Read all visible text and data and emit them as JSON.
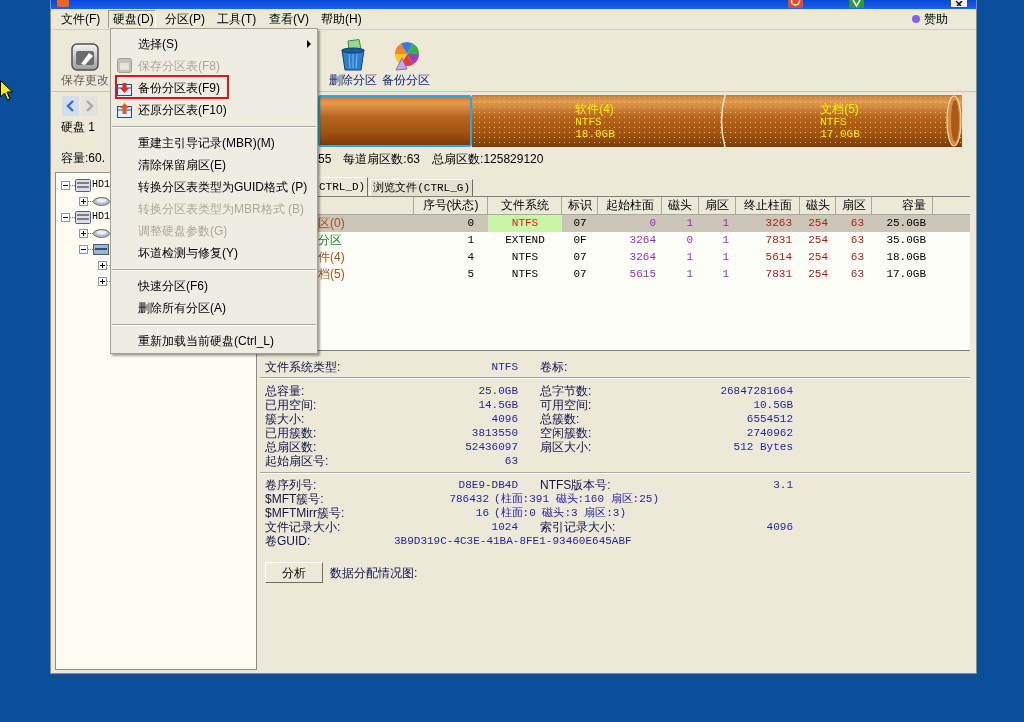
{
  "menu_bar": {
    "items": [
      {
        "label": "文件(F)",
        "selected": false
      },
      {
        "label": "硬盘(D)",
        "selected": true
      },
      {
        "label": "分区(P)",
        "selected": false
      },
      {
        "label": "工具(T)",
        "selected": false
      },
      {
        "label": "查看(V)",
        "selected": false
      },
      {
        "label": "帮助(H)",
        "selected": false
      }
    ],
    "sponsor": "赞助"
  },
  "toolbar": {
    "buttons": [
      {
        "kind": "save",
        "label": "保存更改",
        "disabled": true
      },
      {
        "kind": "delete",
        "label": "删除分区",
        "disabled": false
      },
      {
        "kind": "backup",
        "label": "备份分区",
        "disabled": false
      }
    ]
  },
  "disk_panel": {
    "nav_buttons": [
      {
        "kind": "prev",
        "disabled": false
      },
      {
        "kind": "next",
        "disabled": true
      }
    ],
    "disk_label": "硬盘 1",
    "capacity": "容量:60."
  },
  "disk_map": {
    "segments": [
      {
        "kind": "primary",
        "selected": true
      },
      {
        "kind": "logical",
        "selected": false,
        "name": "软件(4)",
        "filesystem": "NTFS",
        "size": "18.0GB"
      },
      {
        "kind": "logical",
        "selected": false,
        "name": "文档(5)",
        "filesystem": "NTFS",
        "size": "17.0GB"
      }
    ],
    "info": [
      "55",
      "每道扇区数:63",
      "总扇区数:125829120"
    ]
  },
  "tree": [
    {
      "kind": "disk",
      "label": "HD1",
      "expanded": true,
      "children": [
        {
          "kind": "partition",
          "expanded": false
        }
      ]
    },
    {
      "kind": "disk",
      "label": "HD1",
      "expanded": true,
      "children": [
        {
          "kind": "partition",
          "expanded": false
        },
        {
          "kind": "extended",
          "expanded": true,
          "children": [
            {
              "expanded": false
            },
            {
              "expanded": false
            }
          ]
        }
      ]
    }
  ],
  "tabs": [
    {
      "label": "CTRL_D)",
      "selected": true
    },
    {
      "label": "浏览文件(CTRL_G)",
      "selected": false
    }
  ],
  "table": {
    "columns": [
      "序号(状态)",
      "文件系统",
      "标识",
      "起始柱面",
      "磁头",
      "扇区",
      "终止柱面",
      "磁头",
      "扇区",
      "容量"
    ],
    "rows": [
      {
        "kind": "primary",
        "selected": true,
        "name": "区(0)",
        "cells": [
          "0",
          "NTFS",
          "07",
          "0",
          "1",
          "1",
          "3263",
          "254",
          "63",
          "25.0GB"
        ]
      },
      {
        "kind": "extended",
        "selected": false,
        "name": "分区",
        "cells": [
          "1",
          "EXTEND",
          "0F",
          "3264",
          "0",
          "1",
          "7831",
          "254",
          "63",
          "35.0GB"
        ]
      },
      {
        "kind": "logical",
        "selected": false,
        "name": "件(4)",
        "cells": [
          "4",
          "NTFS",
          "07",
          "3264",
          "1",
          "1",
          "5614",
          "254",
          "63",
          "18.0GB"
        ]
      },
      {
        "kind": "logical",
        "selected": false,
        "name": "档(5)",
        "cells": [
          "5",
          "NTFS",
          "07",
          "5615",
          "1",
          "1",
          "7831",
          "254",
          "63",
          "17.0GB"
        ]
      }
    ]
  },
  "details": {
    "sections": [
      {
        "rows": [
          {
            "kind": "pair",
            "left": {
              "label": "文件系统类型:",
              "value": "NTFS"
            },
            "right": {
              "label": "卷标:"
            }
          }
        ]
      },
      {
        "rows": [
          {
            "kind": "pair",
            "left": {
              "label": "总容量:",
              "value": "25.0GB"
            },
            "right": {
              "label": "总字节数:",
              "value": "26847281664"
            }
          },
          {
            "kind": "pair",
            "left": {
              "label": "已用空间:",
              "value": "14.5GB"
            },
            "right": {
              "label": "可用空间:",
              "value": "10.5GB"
            }
          },
          {
            "kind": "pair",
            "left": {
              "label": "簇大小:",
              "value": "4096"
            },
            "right": {
              "label": "总簇数:",
              "value": "6554512"
            }
          },
          {
            "kind": "pair",
            "left": {
              "label": "已用簇数:",
              "value": "3813550"
            },
            "right": {
              "label": "空闲簇数:",
              "value": "2740962"
            }
          },
          {
            "kind": "pair",
            "left": {
              "label": "总扇区数:",
              "value": "52436097"
            },
            "right": {
              "label": "扇区大小:",
              "value": "512 Bytes"
            }
          },
          {
            "kind": "pair",
            "left": {
              "label": "起始扇区号:",
              "value": "63"
            }
          }
        ]
      },
      {
        "rows": [
          {
            "kind": "pair",
            "left": {
              "label": "卷序列号:",
              "value": "D8E9-DB4D"
            },
            "right": {
              "label": "NTFS版本号:",
              "value": "3.1"
            }
          },
          {
            "kind": "detail",
            "left": {
              "label": "$MFT簇号:",
              "value": "786432",
              "detail": "(柱面:391 磁头:160 扇区:25)"
            }
          },
          {
            "kind": "detail",
            "left": {
              "label": "$MFTMirr簇号:",
              "value": "16",
              "detail": "(柱面:0 磁头:3 扇区:3)"
            }
          },
          {
            "kind": "pair",
            "left": {
              "label": "文件记录大小:",
              "value": "1024"
            },
            "right": {
              "label": "索引记录大小:",
              "value": "4096"
            }
          },
          {
            "kind": "wide",
            "left": {
              "label": "卷GUID:",
              "value": "3B9D319C-4C3E-41BA-8FE1-93460E645ABF"
            }
          }
        ]
      }
    ],
    "analyze_button": "分析",
    "chart_label": "数据分配情况图:"
  },
  "dropdown": {
    "items": [
      {
        "kind": "submenu",
        "label": "选择(S)",
        "disabled": false,
        "marked": false
      },
      {
        "kind": "save",
        "label": "保存分区表(F8)",
        "disabled": true,
        "marked": false
      },
      {
        "kind": "backup",
        "label": "备份分区表(F9)",
        "disabled": false,
        "marked": true
      },
      {
        "kind": "restore",
        "label": "还原分区表(F10)",
        "disabled": false,
        "marked": false
      },
      {
        "kind": "separator"
      },
      {
        "kind": "plain",
        "label": "重建主引导记录(MBR)(M)",
        "disabled": false,
        "marked": false
      },
      {
        "kind": "plain",
        "label": "清除保留扇区(E)",
        "disabled": false,
        "marked": false
      },
      {
        "kind": "plain",
        "label": "转换分区表类型为GUID格式 (P)",
        "disabled": false,
        "marked": false
      },
      {
        "kind": "plain",
        "label": "转换分区表类型为MBR格式 (B)",
        "disabled": true,
        "marked": false
      },
      {
        "kind": "plain",
        "label": "调整硬盘参数(G)",
        "disabled": true,
        "marked": false
      },
      {
        "kind": "plain",
        "label": "坏道检测与修复(Y)",
        "disabled": false,
        "marked": false
      },
      {
        "kind": "separator"
      },
      {
        "kind": "plain",
        "label": "快速分区(F6)",
        "disabled": false,
        "marked": false
      },
      {
        "kind": "plain",
        "label": "删除所有分区(A)",
        "disabled": false,
        "marked": false
      },
      {
        "kind": "separator"
      },
      {
        "kind": "plain",
        "label": "重新加载当前硬盘(Ctrl_L)",
        "disabled": false,
        "marked": false
      }
    ]
  }
}
